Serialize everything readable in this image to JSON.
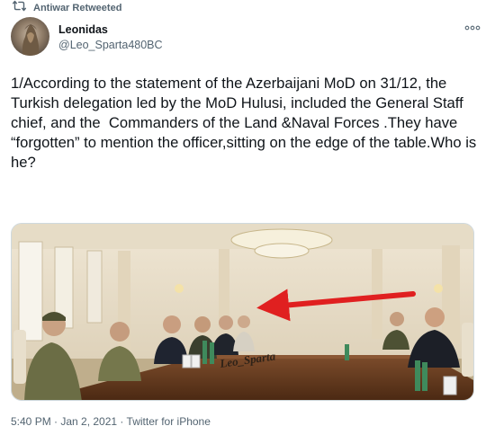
{
  "retweet": {
    "label": "Antiwar Retweeted",
    "icon": "retweet-icon"
  },
  "author": {
    "display_name": "Leonidas",
    "handle": "@Leo_Sparta480BC"
  },
  "tweet": {
    "text": "1/According to the statement of the Azerbaijani MoD on 31/12, the Turkish delegation led by the MoD Hulusi, included the General Staff  chief, and the  Commanders of the Land &Naval Forces .They have “forgotten” to mention the officer,sitting on the edge of the table.Who is he?"
  },
  "media": {
    "watermark": "Leo_Sparta",
    "arrow_color": "#e02020"
  },
  "meta": {
    "timestamp": "5:40 PM · Jan 2, 2021 · Twitter for iPhone"
  },
  "colors": {
    "text_primary": "#0f1419",
    "text_secondary": "#536471",
    "border": "#cfd9de"
  }
}
